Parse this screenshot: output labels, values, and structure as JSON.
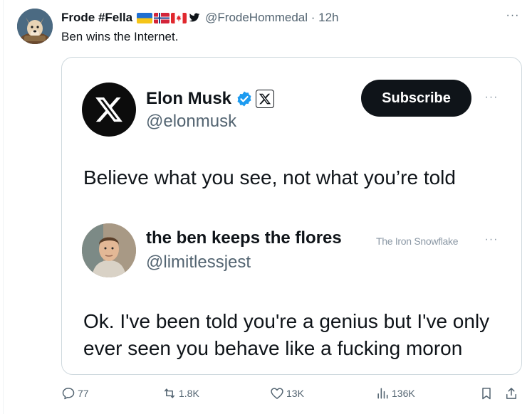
{
  "post": {
    "author_name": "Frode #Fella",
    "flags": [
      "ukraine-flag",
      "norway-flag",
      "canada-flag",
      "twitter-bird-icon"
    ],
    "handle": "@FrodeHommedal",
    "time": "· 12h",
    "more": "···",
    "text": "Ben wins the Internet."
  },
  "embedded": {
    "author_name": "Elon Musk",
    "author_handle": "@elonmusk",
    "subscribe_label": "Subscribe",
    "more": "···",
    "tweet_text": "Believe what you see, not what you’re told",
    "reply": {
      "author_name": "the ben keeps the flores",
      "author_handle": "@limitlessjest",
      "watermark": "The Iron Snowflake",
      "more": "···",
      "text": "Ok. I've been told you're a genius but I've only ever seen you behave like a fucking moron"
    }
  },
  "actions": {
    "reply_count": "77",
    "retweet_count": "1.8K",
    "like_count": "13K",
    "views_count": "136K"
  },
  "colors": {
    "text_primary": "#0f1419",
    "text_secondary": "#536471",
    "verified_blue": "#1d9bf0",
    "border": "#cfd9de"
  }
}
